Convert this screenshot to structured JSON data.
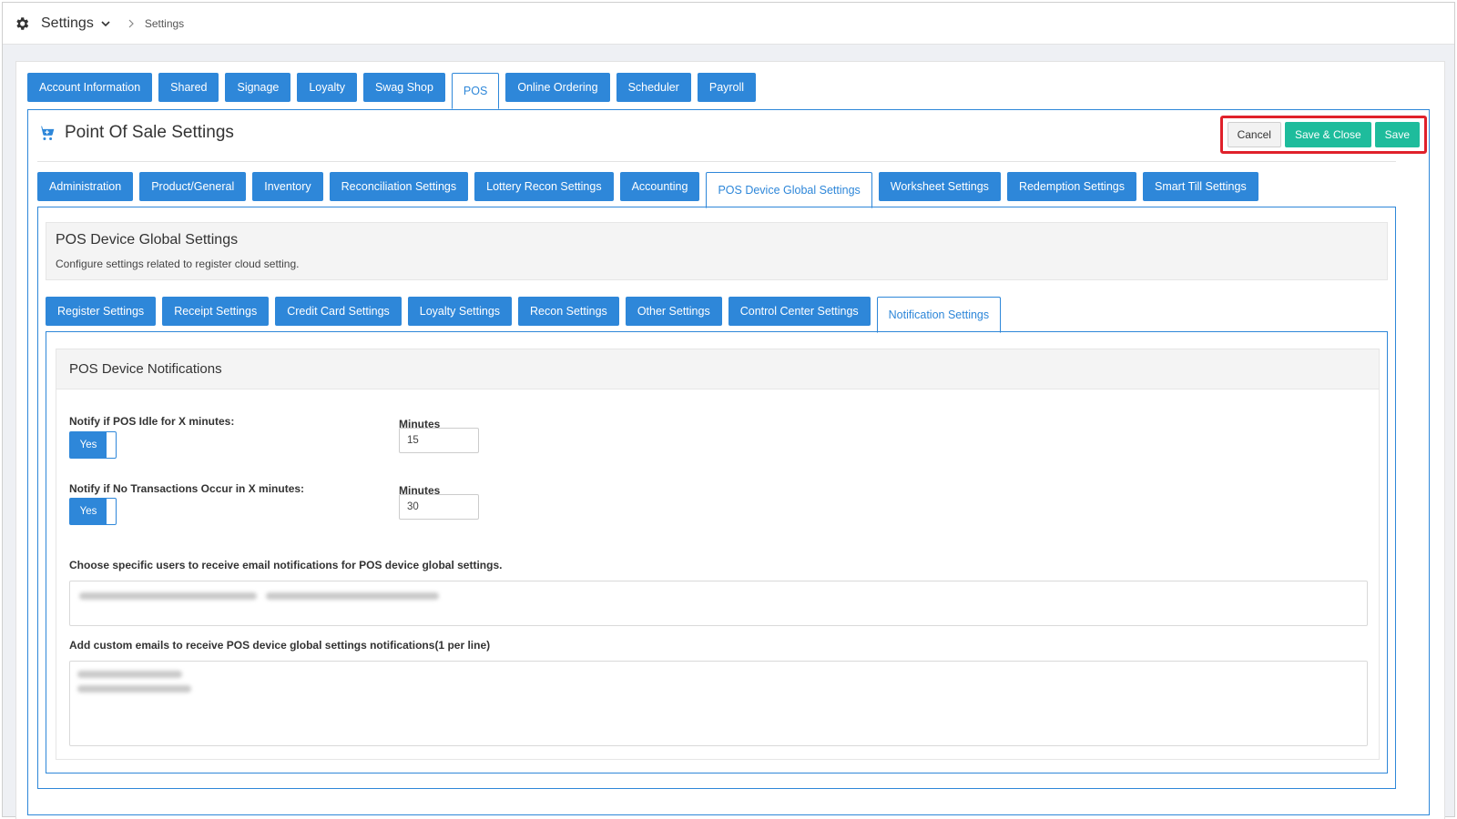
{
  "header": {
    "app_title": "Settings",
    "breadcrumb": "Settings"
  },
  "top_tabs": [
    {
      "label": "Account Information",
      "active": false
    },
    {
      "label": "Shared",
      "active": false
    },
    {
      "label": "Signage",
      "active": false
    },
    {
      "label": "Loyalty",
      "active": false
    },
    {
      "label": "Swag Shop",
      "active": false
    },
    {
      "label": "POS",
      "active": true
    },
    {
      "label": "Online Ordering",
      "active": false
    },
    {
      "label": "Scheduler",
      "active": false
    },
    {
      "label": "Payroll",
      "active": false
    }
  ],
  "pos": {
    "title": "Point Of Sale Settings",
    "actions": {
      "cancel": "Cancel",
      "save_close": "Save & Close",
      "save": "Save"
    },
    "tabs": [
      {
        "label": "Administration",
        "active": false
      },
      {
        "label": "Product/General",
        "active": false
      },
      {
        "label": "Inventory",
        "active": false
      },
      {
        "label": "Reconciliation Settings",
        "active": false
      },
      {
        "label": "Lottery Recon Settings",
        "active": false
      },
      {
        "label": "Accounting",
        "active": false
      },
      {
        "label": "POS Device Global Settings",
        "active": true
      },
      {
        "label": "Worksheet Settings",
        "active": false
      },
      {
        "label": "Redemption Settings",
        "active": false
      },
      {
        "label": "Smart Till Settings",
        "active": false
      }
    ]
  },
  "global": {
    "title": "POS Device Global Settings",
    "description": "Configure settings related to register cloud setting.",
    "tabs": [
      {
        "label": "Register Settings",
        "active": false
      },
      {
        "label": "Receipt Settings",
        "active": false
      },
      {
        "label": "Credit Card Settings",
        "active": false
      },
      {
        "label": "Loyalty Settings",
        "active": false
      },
      {
        "label": "Recon Settings",
        "active": false
      },
      {
        "label": "Other Settings",
        "active": false
      },
      {
        "label": "Control Center Settings",
        "active": false
      },
      {
        "label": "Notification Settings",
        "active": true
      }
    ]
  },
  "notifications": {
    "title": "POS Device Notifications",
    "idle": {
      "label": "Notify if POS Idle for X minutes:",
      "toggle": "Yes",
      "minutes_label": "Minutes",
      "minutes": "15"
    },
    "no_tx": {
      "label": "Notify if No Transactions Occur in X minutes:",
      "toggle": "Yes",
      "minutes_label": "Minutes",
      "minutes": "30"
    },
    "users_label": "Choose specific users to receive email notifications for POS device global settings.",
    "custom_label": "Add custom emails to receive POS device global settings notifications(1 per line)"
  },
  "colors": {
    "tab_blue": "#2e87d9",
    "save_green": "#1ebc9c",
    "highlight_red": "#e0212b"
  }
}
